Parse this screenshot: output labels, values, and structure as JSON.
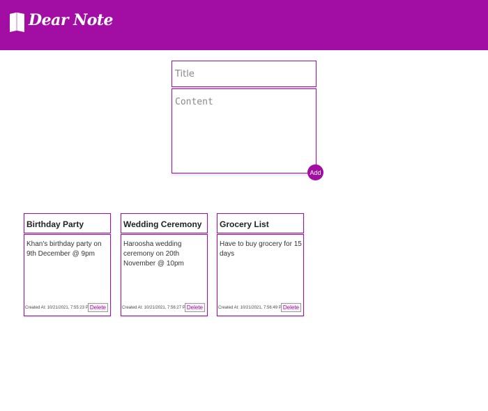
{
  "header": {
    "app_title": "Dear Note",
    "logo_icon": "open-book-icon",
    "background": "#a20ea3"
  },
  "form": {
    "title_placeholder": "Title",
    "content_placeholder": "Content",
    "add_label": "Add"
  },
  "notes": [
    {
      "title": "Birthday Party",
      "content": "Khan's birthday party on 9th December @ 9pm",
      "created": "Created At: 10/21/2021, 7:55:23 PM",
      "delete_label": "Delete"
    },
    {
      "title": "Wedding Ceremony",
      "content": "Haroosha wedding ceremony on 20th November @ 10pm",
      "created": "Created At: 10/21/2021, 7:56:27 PM",
      "delete_label": "Delete"
    },
    {
      "title": "Grocery List",
      "content": "Have to buy grocery for 15 days",
      "created": "Created At: 10/21/2021, 7:56:49 PM",
      "delete_label": "Delete"
    }
  ]
}
